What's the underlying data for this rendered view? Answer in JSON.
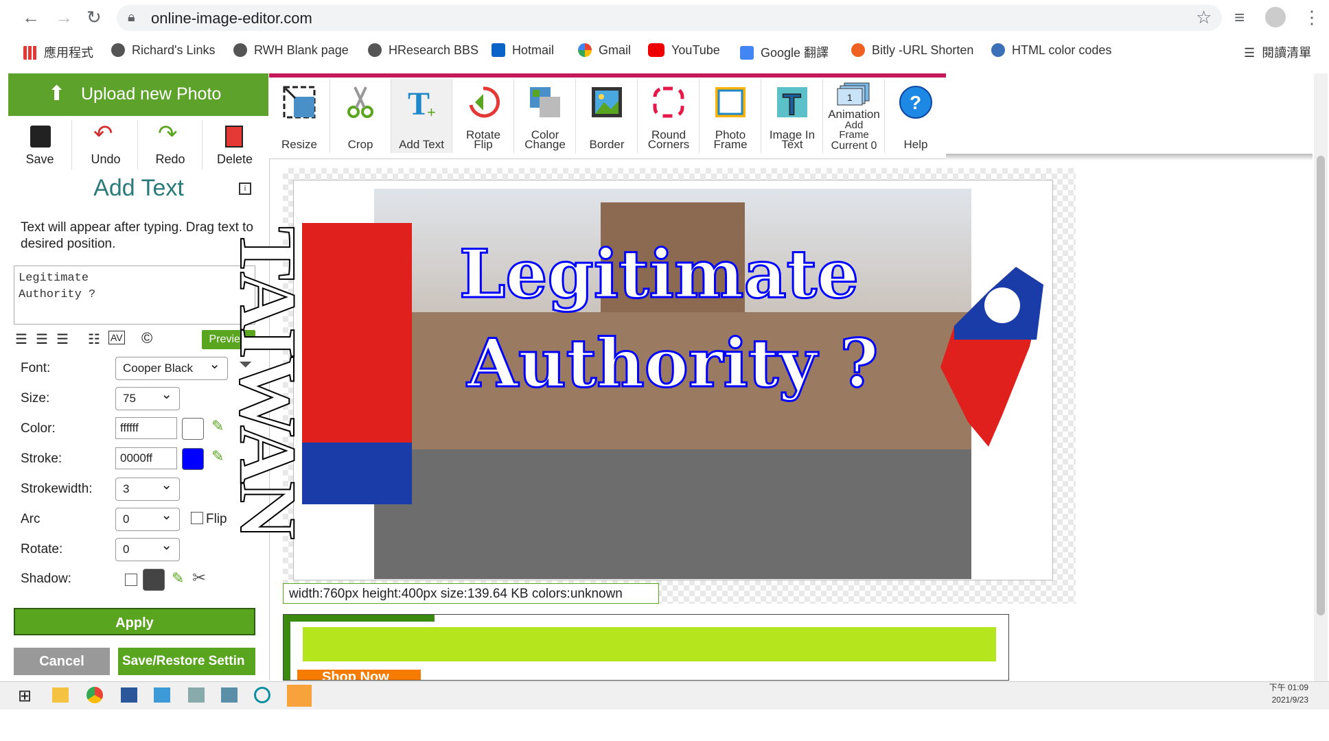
{
  "browser": {
    "url": "online-image-editor.com",
    "bookmarks": [
      "應用程式",
      "Richard's Links",
      "RWH Blank page",
      "HResearch BBS",
      "Hotmail",
      "Gmail",
      "YouTube",
      "Google 翻譯",
      "Bitly -URL Shorten",
      "HTML color codes"
    ],
    "reading_list": "閱讀清單"
  },
  "left_panel": {
    "upload_label": "Upload new Photo",
    "tools": [
      "Save",
      "Undo",
      "Redo",
      "Delete"
    ],
    "title": "Add Text",
    "help_text": "Text will appear after typing. Drag text to desired position.",
    "text_value": "Legitimate\nAuthority ?",
    "preview_label": "Preview",
    "font_label": "Font:",
    "font_value": "Cooper Black",
    "size_label": "Size:",
    "size_value": "75",
    "color_label": "Color:",
    "color_value": "ffffff",
    "stroke_label": "Stroke:",
    "stroke_value": "0000ff",
    "strokewidth_label": "Strokewidth:",
    "strokewidth_value": "3",
    "arc_label": "Arc",
    "arc_value": "0",
    "flip_label": "Flip",
    "rotate_label": "Rotate:",
    "rotate_value": "0",
    "shadow_label": "Shadow:",
    "apply_label": "Apply",
    "cancel_label": "Cancel",
    "save_settings_label": "Save/Restore Settin"
  },
  "toolbar": {
    "resize": "Resize",
    "crop": "Crop",
    "add_text": "Add Text",
    "rotate_1": "Rotate",
    "rotate_2": "Flip",
    "color_1": "Color",
    "color_2": "Change",
    "border": "Border",
    "round_1": "Round",
    "round_2": "Corners",
    "photo_1": "Photo",
    "photo_2": "Frame",
    "image_1": "Image In",
    "image_2": "Text",
    "anim_1": "Animation",
    "anim_2": "Add",
    "anim_3": "Frame",
    "anim_4": "Current 0",
    "help": "Help"
  },
  "canvas": {
    "overlay_line1": "Legitimate",
    "overlay_line2": "Authority ?",
    "side_text": "TAIWAN",
    "info": "width:760px  height:400px  size:139.64 KB  colors:unknown"
  },
  "ad": {
    "shop_now": "Shop Now"
  },
  "taskbar": {
    "time": "下午 01:09",
    "date": "2021/9/23"
  },
  "colors": {
    "accent_green": "#5da22b",
    "toolbar_accent": "#c51a5a",
    "title_teal": "#2a7a7a",
    "stroke_blue": "#0000ff"
  }
}
